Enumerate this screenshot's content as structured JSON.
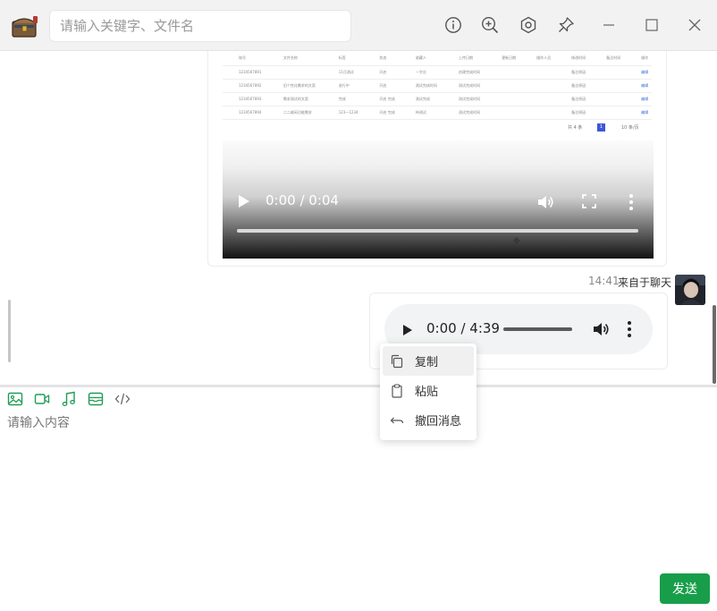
{
  "search": {
    "placeholder": "请输入关键字、文件名"
  },
  "titlebar": {
    "icons": [
      "info-icon",
      "zoom-in-icon",
      "settings-hexagon-icon",
      "pin-icon",
      "minimize-icon",
      "maximize-icon",
      "close-icon"
    ]
  },
  "messages": {
    "video": {
      "time": "0:00 / 0:04",
      "preview_table": {
        "headers": [
          "账号",
          "文件名称",
          "标签",
          "状态",
          "收藏人",
          "上传日期",
          "更新日期",
          "操作人员",
          "修改时间",
          "备注时间",
          "操作"
        ],
        "rows": [
          [
            "1234567891",
            "",
            "11月测试",
            "开启",
            "一字谷",
            "创建完成时间",
            "",
            "",
            "备注原因",
            "",
            "编辑"
          ],
          [
            "1234567892",
            "旧个性化需求的文案",
            "进行中",
            "开启",
            "测试完成时间",
            "测试完成时间",
            "",
            "",
            "备注原因",
            "",
            "编辑"
          ],
          [
            "1234567893",
            "需求测试的文案",
            "完成",
            "开启 完成",
            "测试完成",
            "测试完成时间",
            "",
            "",
            "备注原因",
            "",
            "编辑"
          ],
          [
            "1234567894",
            "二二维码功能需求",
            "123一1234",
            "开启 完成",
            "待测试",
            "测试完成时间",
            "",
            "",
            "备注原因",
            "",
            "编辑"
          ]
        ],
        "pager": {
          "total": "共 4 条",
          "current": "1",
          "size": "10 条/页"
        }
      }
    },
    "audio": {
      "time": "0:00 / 4:39",
      "timestamp": "14:41",
      "source": "来自于聊天"
    }
  },
  "composer": {
    "toolbar_icons": [
      "image-icon",
      "video-icon",
      "music-icon",
      "archive-icon",
      "code-icon"
    ],
    "placeholder": "请输入内容",
    "send_label": "发送"
  },
  "context_menu": {
    "items": [
      {
        "label": "复制",
        "icon": "copy-icon",
        "active": true
      },
      {
        "label": "粘贴",
        "icon": "paste-icon",
        "active": false
      },
      {
        "label": "撤回消息",
        "icon": "undo-icon",
        "active": false
      }
    ]
  },
  "colors": {
    "accent": "#189e4a",
    "icon_green": "#1f9d55",
    "pager_active": "#3d56d6"
  }
}
